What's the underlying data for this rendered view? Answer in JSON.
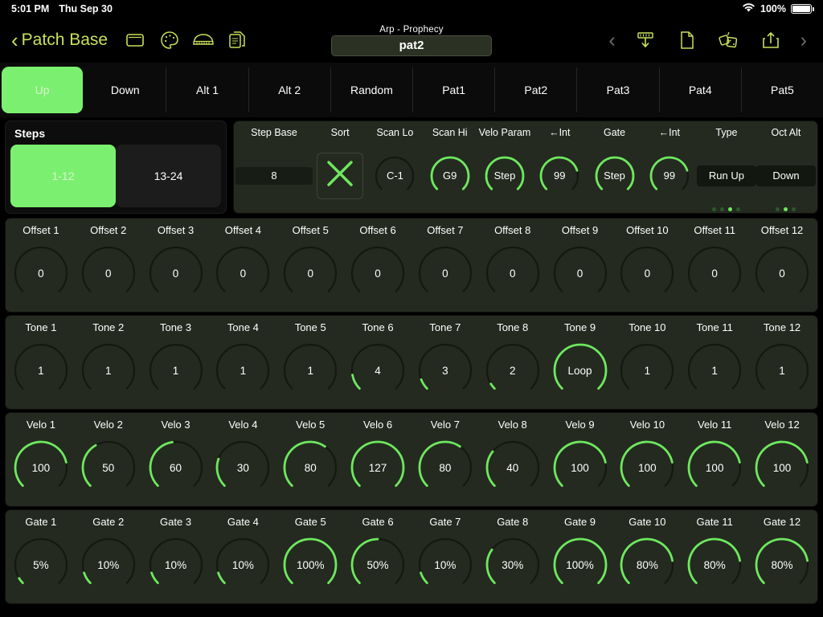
{
  "statusbar": {
    "time": "5:01 PM",
    "date": "Thu Sep 30",
    "battery_percent": "100%",
    "wifi_icon": "wifi-icon",
    "battery_icon": "battery-icon"
  },
  "navbar": {
    "back_label": "Patch Base",
    "back_icon": "chevron-left-icon",
    "left_icons": [
      "window-icon",
      "palette-icon",
      "piano-icon",
      "copy-documents-icon"
    ],
    "right_icons": [
      "chevron-left-icon",
      "download-to-synth-icon",
      "new-file-icon",
      "dice-randomize-icon",
      "share-export-icon",
      "chevron-right-icon"
    ],
    "patch_subtitle": "Arp - Prophecy",
    "patch_name": "pat2"
  },
  "mode_tabs": {
    "items": [
      {
        "label": "Up",
        "active": true
      },
      {
        "label": "Down",
        "active": false
      },
      {
        "label": "Alt 1",
        "active": false
      },
      {
        "label": "Alt 2",
        "active": false
      },
      {
        "label": "Random",
        "active": false
      },
      {
        "label": "Pat1",
        "active": false
      },
      {
        "label": "Pat2",
        "active": false
      },
      {
        "label": "Pat3",
        "active": false
      },
      {
        "label": "Pat4",
        "active": false
      },
      {
        "label": "Pat5",
        "active": false
      }
    ]
  },
  "steps": {
    "title": "Steps",
    "segments": [
      {
        "label": "1-12",
        "active": true
      },
      {
        "label": "13-24",
        "active": false
      }
    ]
  },
  "top_params": [
    {
      "label": "Step Base",
      "value": "8",
      "kind": "numfield"
    },
    {
      "label": "Sort",
      "value": "",
      "kind": "sortx"
    },
    {
      "label": "Scan Lo",
      "value": "C-1",
      "kind": "knob",
      "pct": 0
    },
    {
      "label": "Scan Hi",
      "value": "G9",
      "kind": "knob",
      "pct": 100
    },
    {
      "label": "Velo Param",
      "value": "Step",
      "kind": "knob",
      "pct": 100
    },
    {
      "label": "←Int",
      "value": "99",
      "kind": "knob",
      "pct": 77
    },
    {
      "label": "Gate",
      "value": "Step",
      "kind": "knob",
      "pct": 100
    },
    {
      "label": "←Int",
      "value": "99",
      "kind": "knob",
      "pct": 77
    },
    {
      "label": "Type",
      "value": "Run Up",
      "kind": "pill",
      "dots": 4,
      "dot_active": 3
    },
    {
      "label": "Oct Alt",
      "value": "Down",
      "kind": "pill",
      "dots": 3,
      "dot_active": 2
    }
  ],
  "knob_rows": [
    {
      "name": "offset",
      "labels": [
        "Offset 1",
        "Offset 2",
        "Offset 3",
        "Offset 4",
        "Offset 5",
        "Offset 6",
        "Offset 7",
        "Offset 8",
        "Offset 9",
        "Offset 10",
        "Offset 11",
        "Offset 12"
      ],
      "values": [
        "0",
        "0",
        "0",
        "0",
        "0",
        "0",
        "0",
        "0",
        "0",
        "0",
        "0",
        "0"
      ],
      "pcts": [
        0,
        0,
        0,
        0,
        0,
        0,
        0,
        0,
        0,
        0,
        0,
        0
      ]
    },
    {
      "name": "tone",
      "labels": [
        "Tone 1",
        "Tone 2",
        "Tone 3",
        "Tone 4",
        "Tone 5",
        "Tone 6",
        "Tone 7",
        "Tone 8",
        "Tone 9",
        "Tone 10",
        "Tone 11",
        "Tone 12"
      ],
      "values": [
        "1",
        "1",
        "1",
        "1",
        "1",
        "4",
        "3",
        "2",
        "Loop",
        "1",
        "1",
        "1"
      ],
      "pcts": [
        0,
        0,
        0,
        0,
        0,
        13,
        9,
        5,
        100,
        0,
        0,
        0
      ]
    },
    {
      "name": "velo",
      "labels": [
        "Velo 1",
        "Velo 2",
        "Velo 3",
        "Velo 4",
        "Velo 5",
        "Velo 6",
        "Velo 7",
        "Velo 8",
        "Velo 9",
        "Velo 10",
        "Velo 11",
        "Velo 12"
      ],
      "values": [
        "100",
        "50",
        "60",
        "30",
        "80",
        "127",
        "80",
        "40",
        "100",
        "100",
        "100",
        "100"
      ],
      "pcts": [
        79,
        39,
        47,
        24,
        63,
        100,
        63,
        31,
        79,
        79,
        79,
        79
      ]
    },
    {
      "name": "gate",
      "labels": [
        "Gate 1",
        "Gate 2",
        "Gate 3",
        "Gate 4",
        "Gate 5",
        "Gate 6",
        "Gate 7",
        "Gate 8",
        "Gate 9",
        "Gate 10",
        "Gate 11",
        "Gate 12"
      ],
      "values": [
        "5%",
        "10%",
        "10%",
        "10%",
        "100%",
        "50%",
        "10%",
        "30%",
        "100%",
        "80%",
        "80%",
        "80%"
      ],
      "pcts": [
        5,
        10,
        10,
        10,
        100,
        50,
        10,
        30,
        100,
        80,
        80,
        80
      ]
    }
  ],
  "colors": {
    "accent_green": "#6ee85f",
    "bright_green": "#7bf070",
    "nav_yellow": "#c8e05a",
    "panel_bg": "#242a20",
    "track": "#15180f"
  }
}
